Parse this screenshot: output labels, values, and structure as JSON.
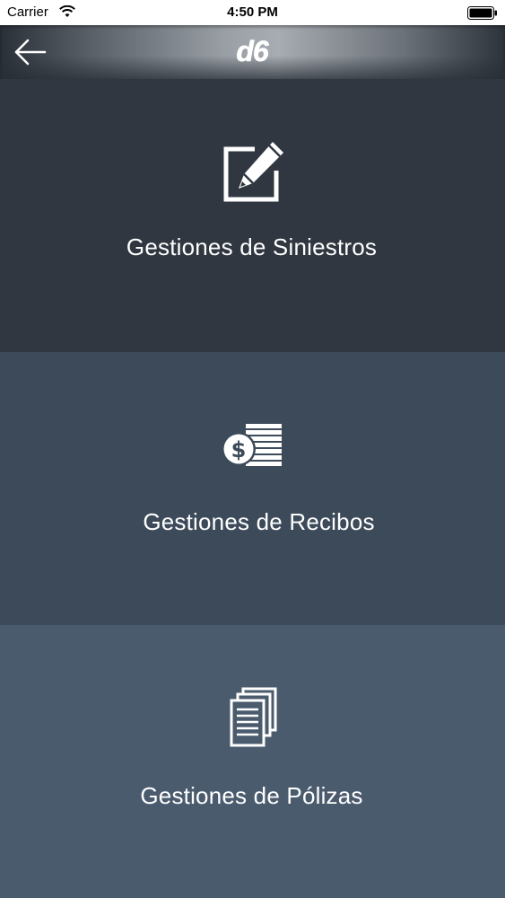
{
  "status_bar": {
    "carrier": "Carrier",
    "time": "4:50 PM",
    "wifi_icon": "wifi-icon",
    "battery_icon": "battery-icon"
  },
  "navbar": {
    "back_icon": "arrow-left-icon",
    "logo_text": "d6"
  },
  "menu": [
    {
      "label": "Gestiones de Siniestros",
      "icon": "edit-icon",
      "color": "#303741"
    },
    {
      "label": "Gestiones de Recibos",
      "icon": "dollar-coins-icon",
      "color": "#3c4a59"
    },
    {
      "label": "Gestiones de Pólizas",
      "icon": "documents-icon",
      "color": "#4b5b6e"
    }
  ]
}
